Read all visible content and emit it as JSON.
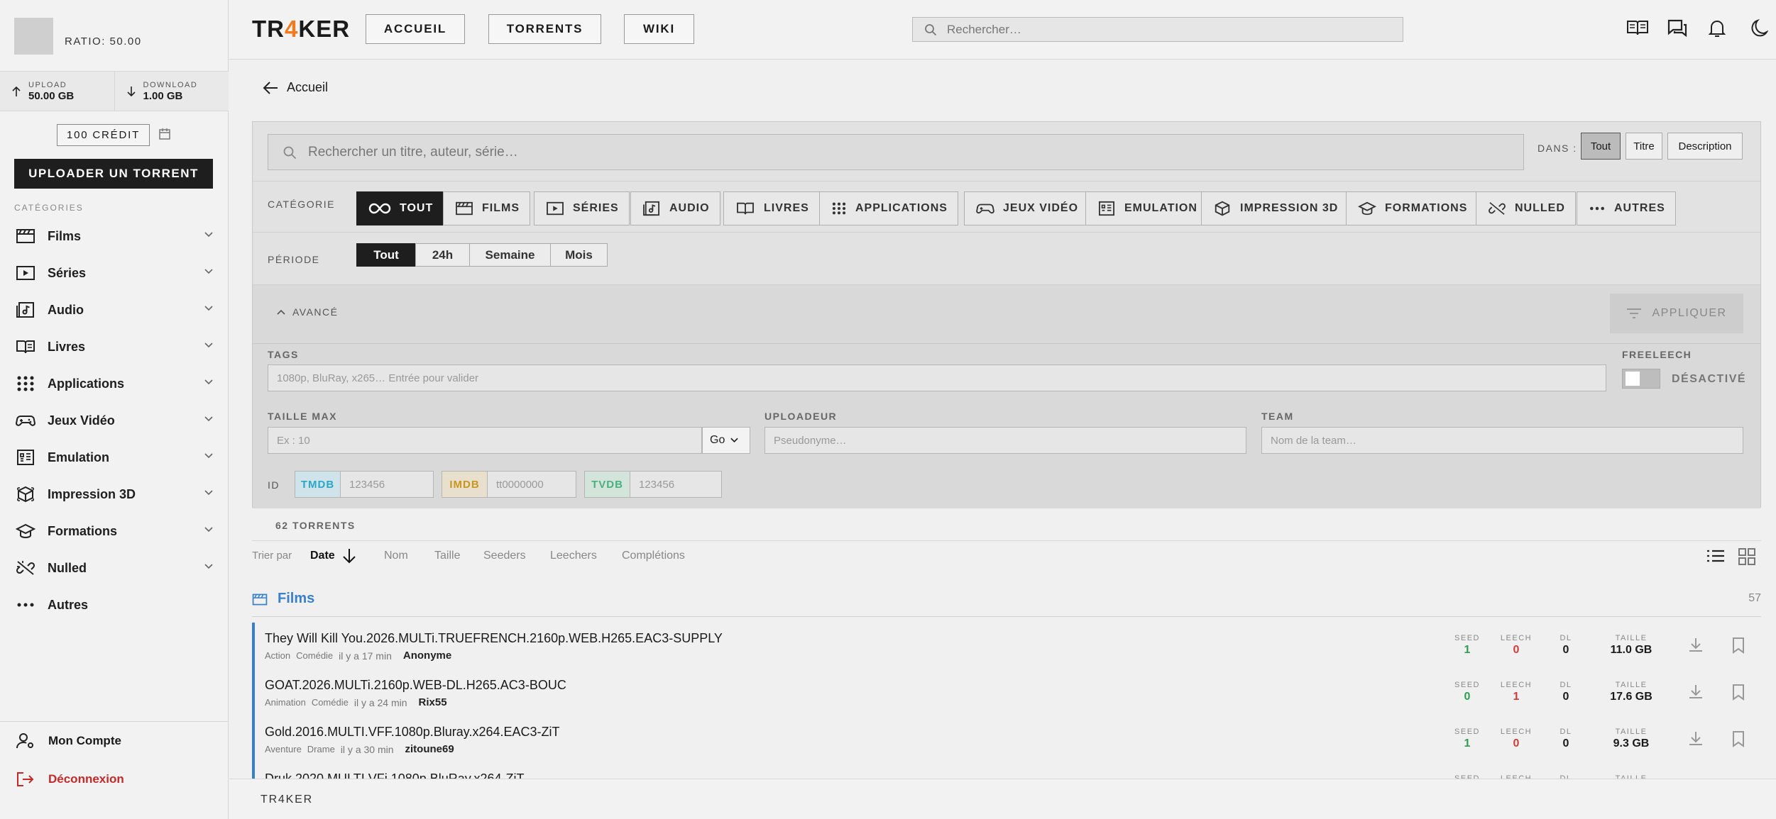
{
  "sidebar": {
    "ratio": "RATIO: 50.00",
    "upload_label": "UPLOAD",
    "upload_value": "50.00 GB",
    "download_label": "DOWNLOAD",
    "download_value": "1.00 GB",
    "credit": "100 CRÉDIT",
    "upload_button": "UPLOADER UN TORRENT",
    "categories_title": "CATÉGORIES",
    "items": [
      {
        "label": "Films",
        "icon": "film-icon"
      },
      {
        "label": "Séries",
        "icon": "play-icon"
      },
      {
        "label": "Audio",
        "icon": "music-icon"
      },
      {
        "label": "Livres",
        "icon": "book-icon"
      },
      {
        "label": "Applications",
        "icon": "grid-dots-icon"
      },
      {
        "label": "Jeux Vidéo",
        "icon": "gamepad-icon"
      },
      {
        "label": "Emulation",
        "icon": "emulation-icon"
      },
      {
        "label": "Impression 3D",
        "icon": "cube-icon"
      },
      {
        "label": "Formations",
        "icon": "graduation-cap-icon"
      },
      {
        "label": "Nulled",
        "icon": "broken-link-icon"
      },
      {
        "label": "Autres",
        "icon": "more-icon"
      }
    ],
    "account": "Mon Compte",
    "logout": "Déconnexion"
  },
  "header": {
    "logo_a": "TR",
    "logo_b": "4",
    "logo_c": "KER",
    "nav": [
      "ACCUEIL",
      "TORRENTS",
      "WIKI"
    ],
    "search_placeholder": "Rechercher…",
    "icons": [
      "book-open-icon",
      "chat-icon",
      "bell-icon",
      "moon-icon"
    ]
  },
  "breadcrumb": {
    "back_label": "Accueil"
  },
  "filters": {
    "search_placeholder": "Rechercher un titre, auteur, série…",
    "dans_label": "DANS :",
    "dans_options": [
      "Tout",
      "Titre",
      "Description"
    ],
    "dans_selected": "Tout",
    "categorie_label": "CATÉGORIE",
    "categories": [
      {
        "label": "TOUT",
        "icon": "infinity-icon"
      },
      {
        "label": "FILMS",
        "icon": "film-icon"
      },
      {
        "label": "SÉRIES",
        "icon": "play-icon"
      },
      {
        "label": "AUDIO",
        "icon": "music-icon"
      },
      {
        "label": "LIVRES",
        "icon": "book-icon"
      },
      {
        "label": "APPLICATIONS",
        "icon": "grid-dots-icon"
      },
      {
        "label": "JEUX VIDÉO",
        "icon": "gamepad-icon"
      },
      {
        "label": "EMULATION",
        "icon": "emulation-icon"
      },
      {
        "label": "IMPRESSION 3D",
        "icon": "cube-icon"
      },
      {
        "label": "FORMATIONS",
        "icon": "graduation-cap-icon"
      },
      {
        "label": "NULLED",
        "icon": "broken-link-icon"
      },
      {
        "label": "AUTRES",
        "icon": "more-icon"
      }
    ],
    "categorie_selected": "TOUT",
    "periode_label": "PÉRIODE",
    "periodes": [
      "Tout",
      "24h",
      "Semaine",
      "Mois"
    ],
    "periode_selected": "Tout",
    "advanced_label": "AVANCÉ",
    "apply_label": "APPLIQUER",
    "tags_label": "TAGS",
    "tags_placeholder": "1080p, BluRay, x265… Entrée pour valider",
    "freeleech_label": "FREELEECH",
    "freeleech_state": "DÉSACTIVÉ",
    "taille_label": "TAILLE MAX",
    "taille_placeholder": "Ex : 10",
    "taille_unit": "Go",
    "uploadeur_label": "UPLOADEUR",
    "uploadeur_placeholder": "Pseudonyme…",
    "team_label": "TEAM",
    "team_placeholder": "Nom de la team…",
    "id_label": "ID",
    "ids": [
      {
        "tag": "TMDB",
        "placeholder": "123456",
        "color": "#2aa7c9"
      },
      {
        "tag": "IMDB",
        "placeholder": "tt0000000",
        "color": "#c9961e"
      },
      {
        "tag": "TVDB",
        "placeholder": "123456",
        "color": "#4bb080"
      }
    ]
  },
  "results": {
    "count": "62 TORRENTS",
    "sort_label": "Trier par",
    "sort_active": "Date",
    "sort_options": [
      "Nom",
      "Taille",
      "Seeders",
      "Leechers",
      "Complétions"
    ],
    "group_title": "Films",
    "group_count": "57",
    "col_labels": {
      "seed": "SEED",
      "leech": "LEECH",
      "dl": "DL",
      "size": "TAILLE"
    },
    "torrents": [
      {
        "name": "They Will Kill You.2026.MULTi.TRUEFRENCH.2160p.WEB.H265.EAC3-SUPPLY",
        "genres": [
          "Action",
          "Comédie"
        ],
        "time": "il y a 17 min",
        "uploader": "Anonyme",
        "seed": "1",
        "leech": "0",
        "dl": "0",
        "size": "11.0 GB"
      },
      {
        "name": "GOAT.2026.MULTi.2160p.WEB-DL.H265.AC3-BOUC",
        "genres": [
          "Animation",
          "Comédie"
        ],
        "time": "il y a 24 min",
        "uploader": "Rix55",
        "seed": "0",
        "leech": "1",
        "dl": "0",
        "size": "17.6 GB"
      },
      {
        "name": "Gold.2016.MULTI.VFF.1080p.Bluray.x264.EAC3-ZiT",
        "genres": [
          "Aventure",
          "Drame"
        ],
        "time": "il y a 30 min",
        "uploader": "zitoune69",
        "seed": "1",
        "leech": "0",
        "dl": "0",
        "size": "9.3 GB"
      },
      {
        "name": "Druk.2020.MULTI.VFi.1080p.BluRay.x264-ZiT",
        "genres": [],
        "time": "",
        "uploader": "",
        "seed": "",
        "leech": "",
        "dl": "",
        "size": ""
      }
    ]
  },
  "footer": {
    "brand": "TR4KER"
  },
  "colors": {
    "accent": "#3a80c8",
    "logo_accent": "#f07a1c",
    "seed": "#2e9e4e",
    "leech": "#d13b3b"
  }
}
